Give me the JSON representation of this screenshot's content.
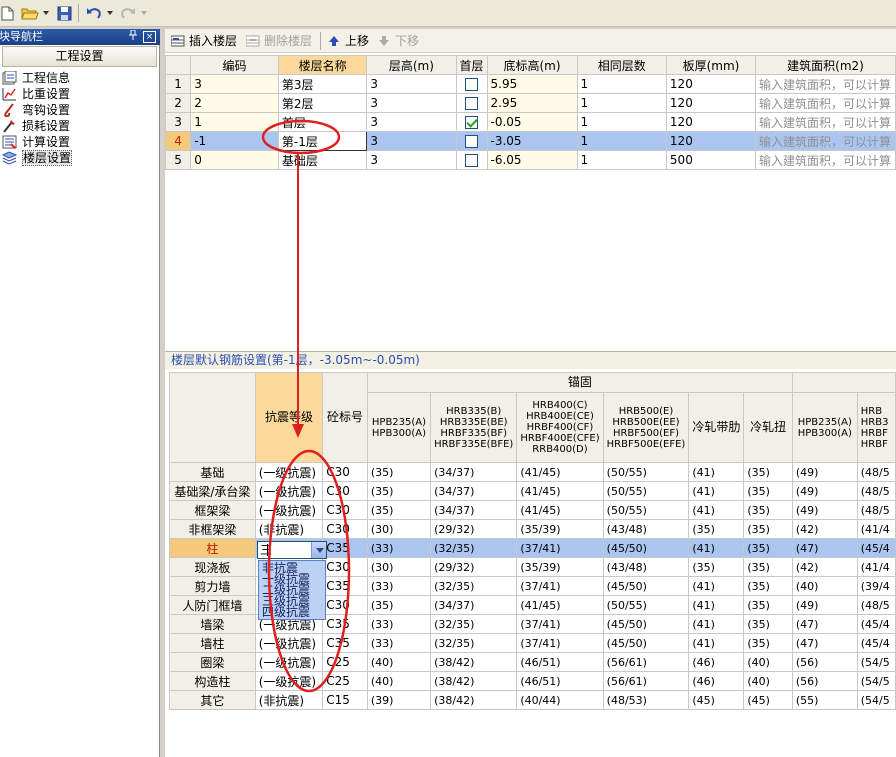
{
  "toolbar": {
    "buttons": [
      "new-file-icon",
      "open-folder-icon",
      "save-icon",
      "undo-icon",
      "redo-icon"
    ]
  },
  "nav": {
    "title": "模块导航栏",
    "pin": "ᵖ",
    "close": "×",
    "section": "工程设置",
    "items": [
      {
        "label": "工程信息",
        "icon": "info-icon"
      },
      {
        "label": "比重设置",
        "icon": "weight-icon"
      },
      {
        "label": "弯钩设置",
        "icon": "hook-icon"
      },
      {
        "label": "损耗设置",
        "icon": "loss-icon"
      },
      {
        "label": "计算设置",
        "icon": "calc-icon"
      },
      {
        "label": "楼层设置",
        "icon": "floor-icon"
      }
    ]
  },
  "floor_toolbar": {
    "insert": "插入楼层",
    "delete": "删除楼层",
    "up": "上移",
    "down": "下移"
  },
  "floor_table": {
    "headers": [
      "编码",
      "楼层名称",
      "层高(m)",
      "首层",
      "底标高(m)",
      "相同层数",
      "板厚(mm)",
      "建筑面积(m2)"
    ],
    "rows": [
      {
        "n": "1",
        "code": "3",
        "name": "第3层",
        "height": "3",
        "first": false,
        "bottom": "5.95",
        "same": "1",
        "thick": "120",
        "area": "输入建筑面积，可以计算"
      },
      {
        "n": "2",
        "code": "2",
        "name": "第2层",
        "height": "3",
        "first": false,
        "bottom": "2.95",
        "same": "1",
        "thick": "120",
        "area": "输入建筑面积，可以计算"
      },
      {
        "n": "3",
        "code": "1",
        "name": "首层",
        "height": "3",
        "first": true,
        "bottom": "-0.05",
        "same": "1",
        "thick": "120",
        "area": "输入建筑面积，可以计算"
      },
      {
        "n": "4",
        "code": "-1",
        "name": "第-1层",
        "height": "3",
        "first": false,
        "bottom": "-3.05",
        "same": "1",
        "thick": "120",
        "area": "输入建筑面积，可以计算"
      },
      {
        "n": "5",
        "code": "0",
        "name": "基础层",
        "height": "3",
        "first": false,
        "bottom": "-6.05",
        "same": "1",
        "thick": "500",
        "area": "输入建筑面积，可以计算"
      }
    ]
  },
  "rebar": {
    "title": "楼层默认钢筋设置(第-1层，-3.05m~-0.05m)",
    "group": "锚固",
    "h_seismic": "抗震等级",
    "h_concrete": "砼标号",
    "cols": [
      "HPB235(A)\nHPB300(A)",
      "HRB335(B)\nHRB335E(BE)\nHRBF335(BF)\nHRBF335E(BFE)",
      "HRB400(C)\nHRB400E(CE)\nHRBF400(CF)\nHRBF400E(CFE)\nRRB400(D)",
      "HRB500(E)\nHRB500E(EE)\nHRBF500(EF)\nHRBF500E(EFE)",
      "冷轧带肋",
      "冷轧扭",
      "HPB235(A)\nHPB300(A)",
      "HRB\nHRB3\nHRBF\nHRBF"
    ],
    "rows": [
      {
        "label": "基础",
        "seismic": "(一级抗震)",
        "concrete": "C30",
        "v": [
          "(35)",
          "(34/37)",
          "(41/45)",
          "(50/55)",
          "(41)",
          "(35)",
          "(49)",
          "(48/5"
        ]
      },
      {
        "label": "基础梁/承台梁",
        "seismic": "(一级抗震)",
        "concrete": "C30",
        "v": [
          "(35)",
          "(34/37)",
          "(41/45)",
          "(50/55)",
          "(41)",
          "(35)",
          "(49)",
          "(48/5"
        ]
      },
      {
        "label": "框架梁",
        "seismic": "(一级抗震)",
        "concrete": "C30",
        "v": [
          "(35)",
          "(34/37)",
          "(41/45)",
          "(50/55)",
          "(41)",
          "(35)",
          "(49)",
          "(48/5"
        ]
      },
      {
        "label": "非框架梁",
        "seismic": "(非抗震)",
        "concrete": "C30",
        "v": [
          "(30)",
          "(29/32)",
          "(35/39)",
          "(43/48)",
          "(35)",
          "(35)",
          "(42)",
          "(41/4"
        ]
      },
      {
        "label": "柱",
        "seismic": "(三",
        "concrete": "C35",
        "v": [
          "(33)",
          "(32/35)",
          "(37/41)",
          "(45/50)",
          "(41)",
          "(35)",
          "(47)",
          "(45/4"
        ]
      },
      {
        "label": "现浇板",
        "seismic": "",
        "concrete": "C30",
        "v": [
          "(30)",
          "(29/32)",
          "(35/39)",
          "(43/48)",
          "(35)",
          "(35)",
          "(42)",
          "(41/4"
        ]
      },
      {
        "label": "剪力墙",
        "seismic": "",
        "concrete": "C35",
        "v": [
          "(33)",
          "(32/35)",
          "(37/41)",
          "(45/50)",
          "(41)",
          "(35)",
          "(40)",
          "(39/4"
        ]
      },
      {
        "label": "人防门框墙",
        "seismic": "",
        "concrete": "C30",
        "v": [
          "(35)",
          "(34/37)",
          "(41/45)",
          "(50/55)",
          "(41)",
          "(35)",
          "(49)",
          "(48/5"
        ]
      },
      {
        "label": "墙梁",
        "seismic": "(一级抗震)",
        "concrete": "C35",
        "v": [
          "(33)",
          "(32/35)",
          "(37/41)",
          "(45/50)",
          "(41)",
          "(35)",
          "(47)",
          "(45/4"
        ]
      },
      {
        "label": "墙柱",
        "seismic": "(一级抗震)",
        "concrete": "C35",
        "v": [
          "(33)",
          "(32/35)",
          "(37/41)",
          "(45/50)",
          "(41)",
          "(35)",
          "(47)",
          "(45/4"
        ]
      },
      {
        "label": "圈梁",
        "seismic": "(一级抗震)",
        "concrete": "C25",
        "v": [
          "(40)",
          "(38/42)",
          "(46/51)",
          "(56/61)",
          "(46)",
          "(40)",
          "(56)",
          "(54/5"
        ]
      },
      {
        "label": "构造柱",
        "seismic": "(一级抗震)",
        "concrete": "C25",
        "v": [
          "(40)",
          "(38/42)",
          "(46/51)",
          "(56/61)",
          "(46)",
          "(40)",
          "(56)",
          "(54/5"
        ]
      },
      {
        "label": "其它",
        "seismic": "(非抗震)",
        "concrete": "C15",
        "v": [
          "(39)",
          "(38/42)",
          "(40/44)",
          "(48/53)",
          "(45)",
          "(45)",
          "(55)",
          "(54/5"
        ]
      }
    ]
  },
  "dropdown": {
    "value": "三",
    "options": [
      "非抗震",
      "一级抗震",
      "二级抗震",
      "三级抗震",
      "四级抗震"
    ]
  },
  "colors": {
    "selection": "#aac6f0",
    "header_highlight": "#fad99a",
    "annotation": "#e02020"
  }
}
